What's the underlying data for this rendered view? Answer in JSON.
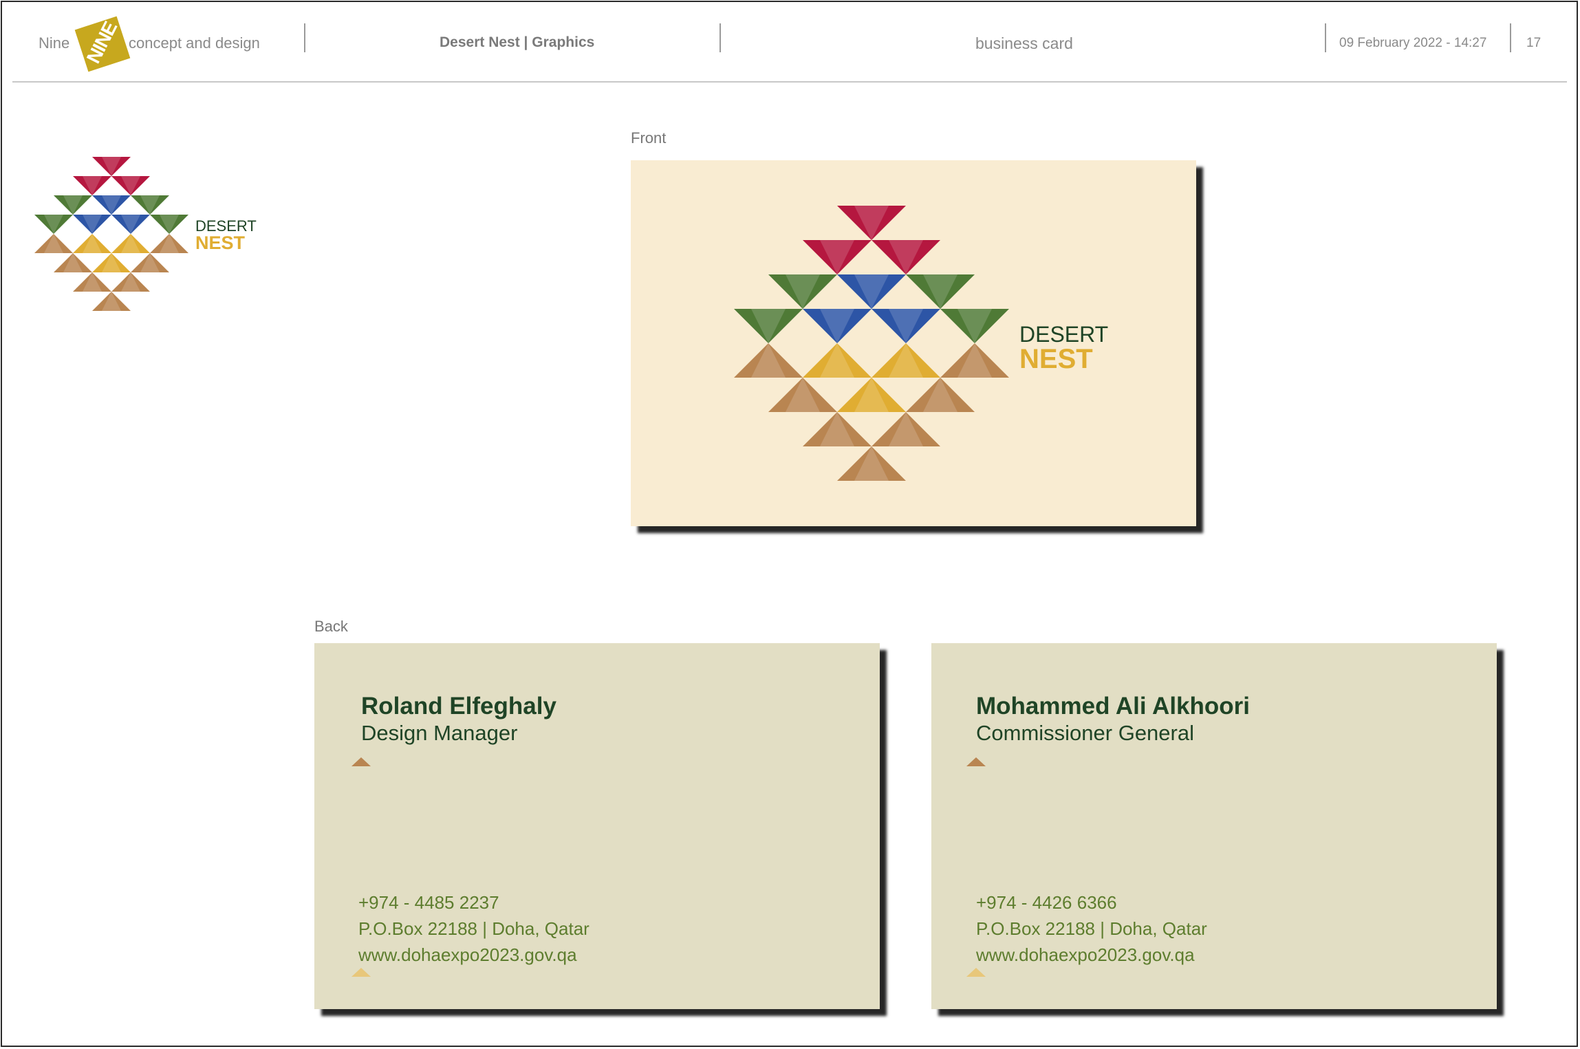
{
  "header": {
    "studio_prefix": "Nine",
    "studio_logo_text": "NINE",
    "studio_suffix": "concept and design",
    "project": "Desert Nest | Graphics",
    "section": "business card",
    "date": "09  February  2022  -  14:27",
    "page_number": "17"
  },
  "brand": {
    "word1": "DESERT",
    "word2": "NEST"
  },
  "labels": {
    "front": "Front",
    "back": "Back"
  },
  "cards": [
    {
      "name": "Roland Elfeghaly",
      "title": "Design Manager",
      "phone": "+974 - 4485 2237",
      "address": "P.O.Box 22188 | Doha, Qatar",
      "website": "www.dohaexpo2023.gov.qa"
    },
    {
      "name": "Mohammed Ali Alkhoori",
      "title": "Commissioner General",
      "phone": "+974 - 4426 6366",
      "address": "P.O.Box 22188 | Doha, Qatar",
      "website": "www.dohaexpo2023.gov.qa"
    }
  ],
  "colors": {
    "crimson": "#b5173f",
    "green": "#4f7a36",
    "blue": "#2d55a6",
    "gold": "#e0ad32",
    "tan": "#b98551",
    "dark_green_text": "#1f4426",
    "front_bg": "#f9ecd2",
    "back_bg": "#e2dec4"
  }
}
